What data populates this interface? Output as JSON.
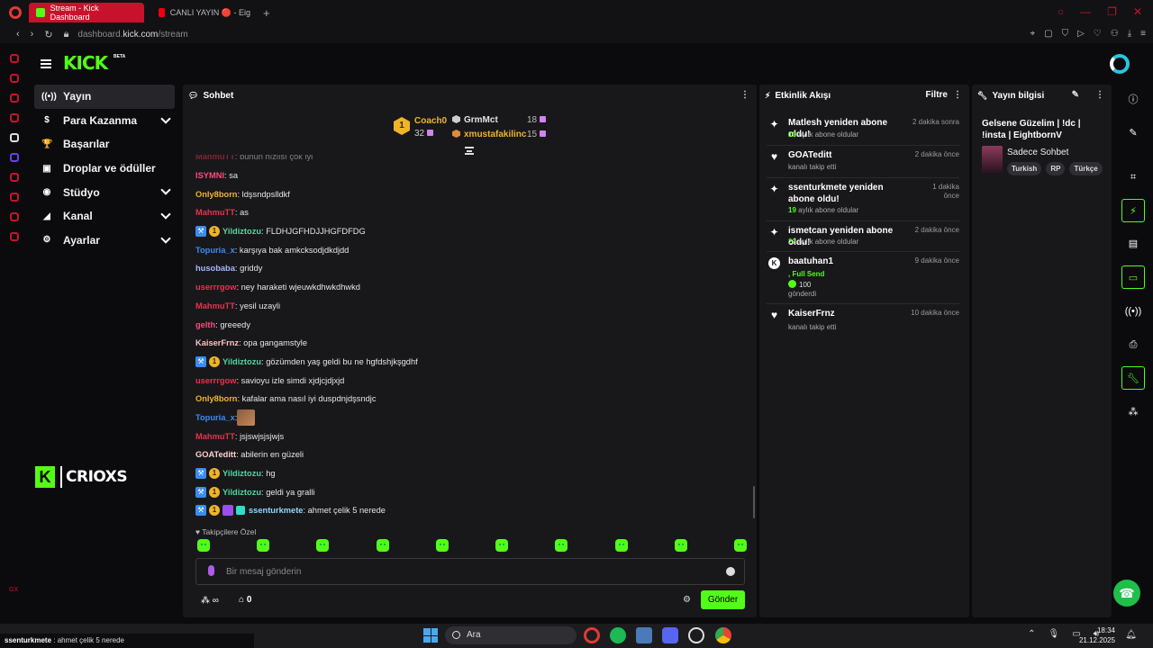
{
  "browser": {
    "tabs": [
      {
        "label": "Stream - Kick Dashboard",
        "active": true
      },
      {
        "label": "CANLI YAYIN 🔴 - Eig",
        "active": false
      }
    ],
    "address": {
      "prefix": "dashboard.",
      "domain": "kick.com",
      "path": "/stream"
    }
  },
  "header": {
    "logo": "KICK",
    "beta": "BETA"
  },
  "leftnav": {
    "items": [
      {
        "label": "Yayın",
        "icon": "broadcast-icon",
        "glyph": "((•))"
      },
      {
        "label": "Para Kazanma",
        "icon": "dollar-icon",
        "glyph": "$"
      },
      {
        "label": "Başarılar",
        "icon": "trophy-icon",
        "glyph": "🏆"
      },
      {
        "label": "Droplar ve ödüller",
        "icon": "gift-icon",
        "glyph": "▣"
      },
      {
        "label": "Stüdyo",
        "icon": "camera-icon",
        "glyph": "◉"
      },
      {
        "label": "Kanal",
        "icon": "megaphone-icon",
        "glyph": "◢"
      },
      {
        "label": "Ayarlar",
        "icon": "gear-icon",
        "glyph": "⚙"
      }
    ],
    "channel_logo_letter": "K",
    "channel_name": "CRIOXS",
    "gx": "GX"
  },
  "chat": {
    "title": "Sohbet",
    "leaderboard": {
      "first": {
        "rank": "1",
        "name": "Coach0",
        "count": "32"
      },
      "second": {
        "name": "GrmMct",
        "count": "18"
      },
      "third": {
        "name": "xmustafakilinc",
        "count": "15"
      }
    },
    "messages": [
      {
        "user": "MahmuTT",
        "text": ": bunun hızlısı çok iyi",
        "color": "#e8334b",
        "badges": []
      },
      {
        "user": "ISYMNI",
        "text": ": sa",
        "color": "#ff4a7a",
        "badges": []
      },
      {
        "user": "Only8born",
        "text": ": ldşsndpslldkf",
        "color": "#f0b429",
        "badges": []
      },
      {
        "user": "MahmuTT",
        "text": ": as",
        "color": "#e8334b",
        "badges": []
      },
      {
        "user": "Yildiztozu",
        "text": ": FLDHJGFHDJJHGFDFDG",
        "color": "#53d6a0",
        "badges": [
          "blue",
          "gold"
        ]
      },
      {
        "user": "Topuria_x",
        "text": ": karşıya bak amkcksodjdkdjdd",
        "color": "#3a8cf0",
        "badges": []
      },
      {
        "user": "husobaba",
        "text": ": griddy",
        "color": "#a7b6ff",
        "badges": []
      },
      {
        "user": "userrrgow",
        "text": ": ney haraketi wjeuwkdhwkdhwkd",
        "color": "#e8334b",
        "badges": []
      },
      {
        "user": "MahmuTT",
        "text": ": yesil uzayli",
        "color": "#e8334b",
        "badges": []
      },
      {
        "user": "gelth",
        "text": ": greeedy",
        "color": "#ff4a7a",
        "badges": []
      },
      {
        "user": "KaiserFrnz",
        "text": ": opa gangamstyle",
        "color": "#ffc0c0",
        "badges": []
      },
      {
        "user": "Yildiztozu",
        "text": ": gözümden yaş geldi bu ne hgfdshjkşgdhf",
        "color": "#53d6a0",
        "badges": [
          "blue",
          "gold"
        ]
      },
      {
        "user": "userrrgow",
        "text": ": savioyu izle simdi xjdjcjdjxjd",
        "color": "#e8334b",
        "badges": []
      },
      {
        "user": "Only8born",
        "text": ": kafalar ama nasıl iyi duspdnjdşsndjc",
        "color": "#f0b429",
        "badges": []
      },
      {
        "user": "Topuria_x",
        "text": ": ",
        "color": "#3a8cf0",
        "badges": [],
        "emote": true
      },
      {
        "user": "MahmuTT",
        "text": ": jsjswjsjsjwjs",
        "color": "#e8334b",
        "badges": []
      },
      {
        "user": "GOATeditt",
        "text": ": abilerin en güzeli",
        "color": "#ffd0d0",
        "badges": []
      },
      {
        "user": "Yildiztozu",
        "text": ": hg",
        "color": "#53d6a0",
        "badges": [
          "blue",
          "gold"
        ]
      },
      {
        "user": "Yildiztozu",
        "text": ": geldi ya gralli",
        "color": "#53d6a0",
        "badges": [
          "blue",
          "gold"
        ]
      },
      {
        "user": "ssenturkmete",
        "text": ": ahmet çelik 5 nerede",
        "color": "#8fd8ff",
        "badges": [
          "blue",
          "gold",
          "purp",
          "cyan"
        ]
      }
    ],
    "followers_only_label": "♥ Takipçilere Özel",
    "input_placeholder": "Bir mesaj gönderin",
    "points_label": "∞",
    "store_count": "0",
    "send_label": "Gönder"
  },
  "activity": {
    "title": "Etkinlik Akışı",
    "filter_label": "Filtre",
    "events": [
      {
        "name": "Matlesh yeniden abone oldu!",
        "time": "2 dakika sonra",
        "sub_num": "10",
        "sub_text": " aylık abone oldular",
        "icon": "sparkle-icon"
      },
      {
        "name": "GOATeditt",
        "time": "2 dakika önce",
        "sub_num": "",
        "sub_text": "kanalı takip etti",
        "icon": "heart-icon"
      },
      {
        "name": "ssenturkmete yeniden abone oldu!",
        "time": "1 dakika önce",
        "sub_num": "19",
        "sub_text": " aylık abone oldular",
        "icon": "sparkle-icon"
      },
      {
        "name": "ismetcan yeniden abone oldu!",
        "time": "2 dakika önce",
        "sub_num": "22",
        "sub_text": " aylık abone oldular",
        "icon": "sparkle-icon"
      },
      {
        "name": "baatuhan1",
        "time": "9 dakika önce",
        "sub_num": "",
        "sub_text": "gönderdi",
        "icon": "kick-coin-icon",
        "extra": ", Full Send",
        "amount": "100"
      },
      {
        "name": "KaiserFrnz",
        "time": "10 dakika önce",
        "sub_num": "",
        "sub_text": "kanalı takip etti",
        "icon": "heart-icon"
      }
    ]
  },
  "stream_info": {
    "title": "Yayın bilgisi",
    "stream_title": "Gelsene Güzelim | !dc | !insta | EightbornV",
    "category": "Sadece Sohbet",
    "tags": [
      "Turkish",
      "RP",
      "Türkçe"
    ]
  },
  "taskbar": {
    "toast_user": "ssenturkmete",
    "toast_text": " : ahmet çelik 5 nerede",
    "search": "Ara",
    "time": "18:34",
    "date": "21.12.2025"
  },
  "colors": {
    "accent": "#53fc18",
    "panel": "#18181b",
    "background": "#0b0b0d"
  }
}
